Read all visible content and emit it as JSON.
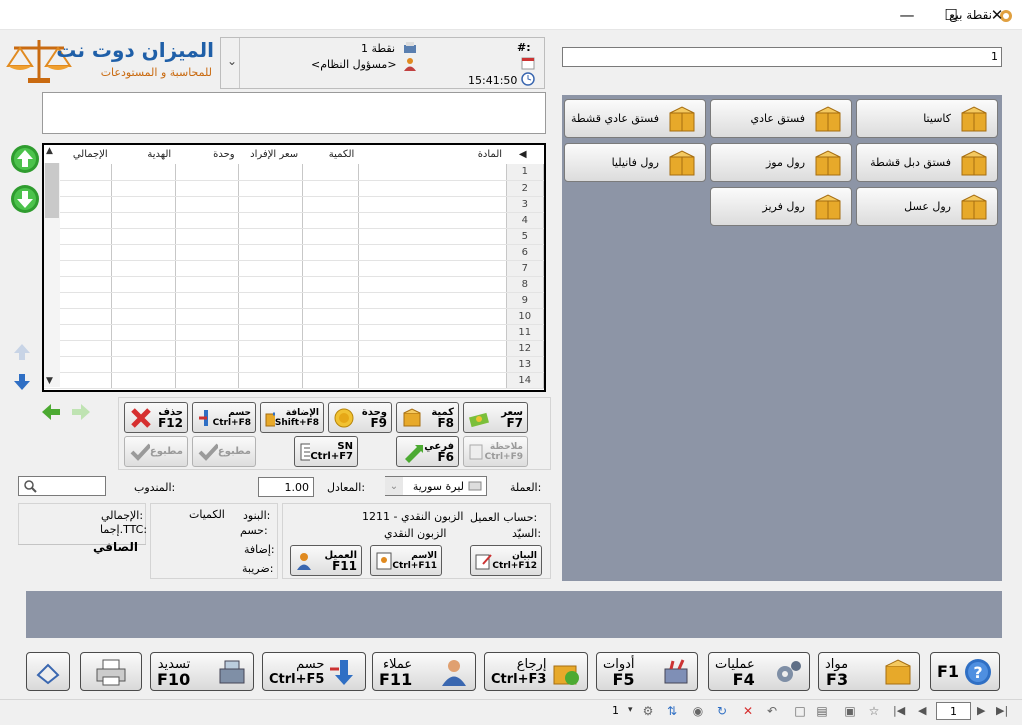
{
  "window": {
    "title": "نقطة بيع"
  },
  "header": {
    "point_label": "نقطة 1",
    "user_label": "<مسؤول النظام>",
    "hash_label": "#:",
    "time": "15:41:50",
    "logo_main": "الميزان دوت نت",
    "logo_sub": "للمحاسبة و المستودعات"
  },
  "search": {
    "value": "1"
  },
  "products": [
    {
      "label": "كاسيتا"
    },
    {
      "label": "فستق عادي"
    },
    {
      "label": "فستق عادي قشطة"
    },
    {
      "label": "فستق دبل قشطة"
    },
    {
      "label": "رول موز"
    },
    {
      "label": "رول فانيليا"
    },
    {
      "label": "رول عسل"
    },
    {
      "label": "رول فريز"
    }
  ],
  "grid": {
    "columns": [
      "المادة",
      "الكمية",
      "سعر الإفراد",
      "وحدة",
      "الهدية",
      "الإجمالي"
    ],
    "rows": [
      "1",
      "2",
      "3",
      "4",
      "5",
      "6",
      "7",
      "8",
      "9",
      "10",
      "11",
      "12",
      "13",
      "14"
    ]
  },
  "actions": {
    "price": {
      "label": "سعر",
      "key": "F7"
    },
    "qty": {
      "label": "كمية",
      "key": "F8"
    },
    "unit": {
      "label": "وحدة",
      "key": "F9"
    },
    "add": {
      "label": "الإضافة",
      "key": "Shift+F8"
    },
    "discount": {
      "label": "حسم",
      "key": "Ctrl+F8"
    },
    "delete": {
      "label": "حذف",
      "key": "F12"
    },
    "note": {
      "label": "ملاحظة",
      "key": "Ctrl+F9"
    },
    "sub": {
      "label": "فرعي",
      "key": "F6"
    },
    "sn": {
      "label": "SN",
      "key": "Ctrl+F7"
    },
    "printed1": {
      "label": "مطبوع"
    },
    "printed2": {
      "label": "مطبوع"
    }
  },
  "currency": {
    "label": "العملة:",
    "value": "ليرة سورية",
    "rate_label": "المعادل:",
    "rate": "1.00",
    "rep_label": "المندوب:"
  },
  "customer": {
    "account_label": "حساب العميل:",
    "account_value": "1211 - الزبون النقدي",
    "sir_label": "السيّد:",
    "sir_value": "الزبون النقدي",
    "btn_statement": {
      "label": "البيان",
      "key": "Ctrl+F12"
    },
    "btn_name": {
      "label": "الاسم",
      "key": "Ctrl+F11"
    },
    "btn_customer": {
      "label": "العميل",
      "key": "F11"
    }
  },
  "summary": {
    "items": "البنود:",
    "quantities": "الكميات",
    "discount": "حسم:",
    "addition": "إضافة:",
    "tax": "ضريبة:",
    "total": "الإجمالي:",
    "total_ttc": "إجما.TTC:",
    "net": "الصافي"
  },
  "bottom_buttons": [
    {
      "label": "",
      "key": "F1"
    },
    {
      "label": "مواد",
      "key": "F3"
    },
    {
      "label": "عمليات",
      "key": "F4"
    },
    {
      "label": "أدوات",
      "key": "F5"
    },
    {
      "label": "إرجاع",
      "key": "Ctrl+F3"
    },
    {
      "label": "عملاء",
      "key": "F11"
    },
    {
      "label": "حسم",
      "key": "Ctrl+F5"
    },
    {
      "label": "تسديد",
      "key": "F10"
    }
  ],
  "statusbar": {
    "page": "1",
    "count": "1"
  }
}
